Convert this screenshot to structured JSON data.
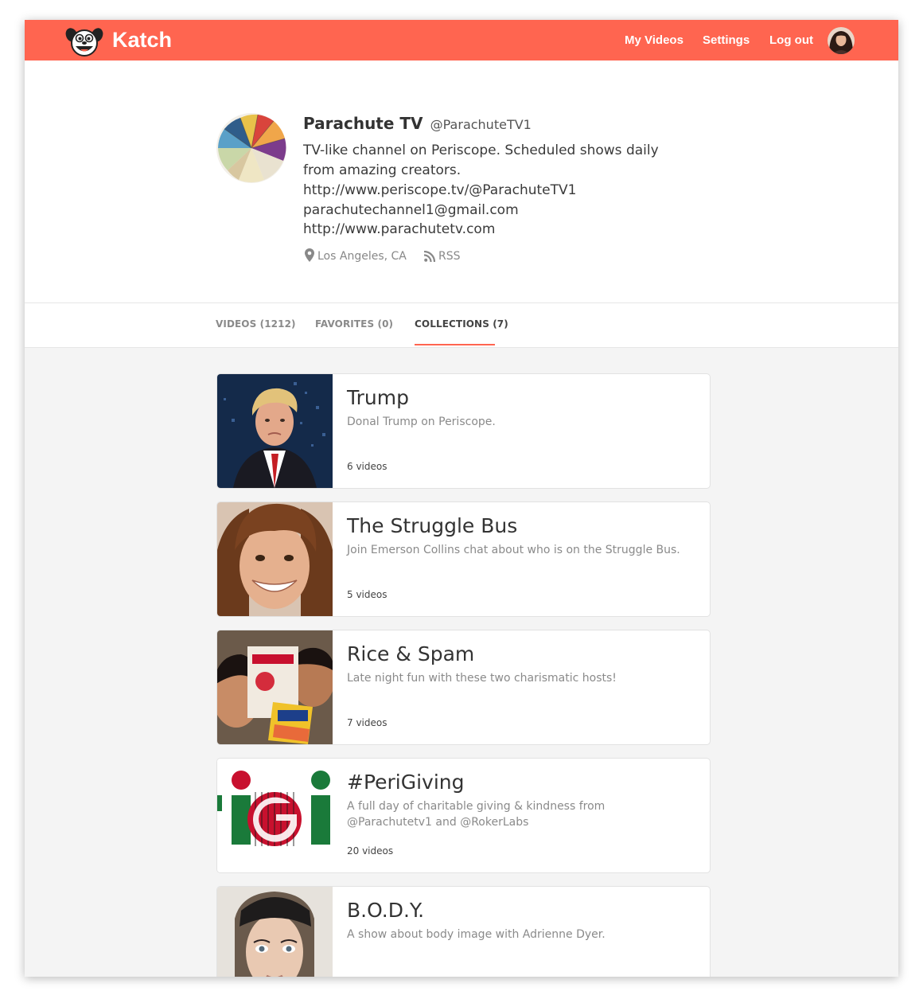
{
  "header": {
    "brand": "Katch",
    "nav": {
      "my_videos": "My Videos",
      "settings": "Settings",
      "logout": "Log out"
    },
    "accent_color": "#ff6550"
  },
  "profile": {
    "name": "Parachute TV",
    "handle": "@ParachuteTV1",
    "bio_lines": [
      "TV-like channel on Periscope. Scheduled shows daily",
      "from amazing creators.",
      "http://www.periscope.tv/@ParachuteTV1",
      "parachutechannel1@gmail.com",
      "http://www.parachutetv.com"
    ],
    "location": "Los Angeles, CA",
    "rss": "RSS"
  },
  "tabs": [
    {
      "label": "VIDEOS (1212)",
      "active": false
    },
    {
      "label": "FAVORITES (0)",
      "active": false
    },
    {
      "label": "COLLECTIONS (7)",
      "active": true
    }
  ],
  "collections": [
    {
      "title": "Trump",
      "description": "Donal Trump on Periscope.",
      "count": "6 videos"
    },
    {
      "title": "The Struggle Bus",
      "description": "Join Emerson Collins chat about who is on the Struggle Bus.",
      "count": "5 videos"
    },
    {
      "title": "Rice & Spam",
      "description": "Late night fun with these two charismatic hosts!",
      "count": "7 videos"
    },
    {
      "title": "#PeriGiving",
      "description": "A full day of charitable giving & kindness from @Parachutetv1 and @RokerLabs",
      "count": "20 videos",
      "thumb_text": "iGi"
    },
    {
      "title": "B.O.D.Y.",
      "description": "A show about body image with Adrienne Dyer.",
      "count": ""
    }
  ]
}
